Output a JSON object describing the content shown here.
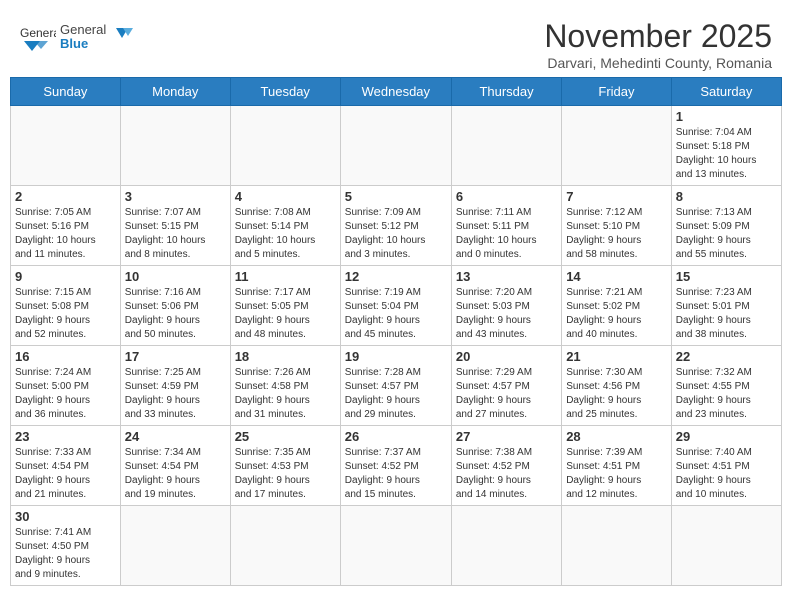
{
  "header": {
    "logo_general": "General",
    "logo_blue": "Blue",
    "month_title": "November 2025",
    "subtitle": "Darvari, Mehedinti County, Romania"
  },
  "weekdays": [
    "Sunday",
    "Monday",
    "Tuesday",
    "Wednesday",
    "Thursday",
    "Friday",
    "Saturday"
  ],
  "days": {
    "d1": {
      "num": "1",
      "info": "Sunrise: 7:04 AM\nSunset: 5:18 PM\nDaylight: 10 hours\nand 13 minutes."
    },
    "d2": {
      "num": "2",
      "info": "Sunrise: 7:05 AM\nSunset: 5:16 PM\nDaylight: 10 hours\nand 11 minutes."
    },
    "d3": {
      "num": "3",
      "info": "Sunrise: 7:07 AM\nSunset: 5:15 PM\nDaylight: 10 hours\nand 8 minutes."
    },
    "d4": {
      "num": "4",
      "info": "Sunrise: 7:08 AM\nSunset: 5:14 PM\nDaylight: 10 hours\nand 5 minutes."
    },
    "d5": {
      "num": "5",
      "info": "Sunrise: 7:09 AM\nSunset: 5:12 PM\nDaylight: 10 hours\nand 3 minutes."
    },
    "d6": {
      "num": "6",
      "info": "Sunrise: 7:11 AM\nSunset: 5:11 PM\nDaylight: 10 hours\nand 0 minutes."
    },
    "d7": {
      "num": "7",
      "info": "Sunrise: 7:12 AM\nSunset: 5:10 PM\nDaylight: 9 hours\nand 58 minutes."
    },
    "d8": {
      "num": "8",
      "info": "Sunrise: 7:13 AM\nSunset: 5:09 PM\nDaylight: 9 hours\nand 55 minutes."
    },
    "d9": {
      "num": "9",
      "info": "Sunrise: 7:15 AM\nSunset: 5:08 PM\nDaylight: 9 hours\nand 52 minutes."
    },
    "d10": {
      "num": "10",
      "info": "Sunrise: 7:16 AM\nSunset: 5:06 PM\nDaylight: 9 hours\nand 50 minutes."
    },
    "d11": {
      "num": "11",
      "info": "Sunrise: 7:17 AM\nSunset: 5:05 PM\nDaylight: 9 hours\nand 48 minutes."
    },
    "d12": {
      "num": "12",
      "info": "Sunrise: 7:19 AM\nSunset: 5:04 PM\nDaylight: 9 hours\nand 45 minutes."
    },
    "d13": {
      "num": "13",
      "info": "Sunrise: 7:20 AM\nSunset: 5:03 PM\nDaylight: 9 hours\nand 43 minutes."
    },
    "d14": {
      "num": "14",
      "info": "Sunrise: 7:21 AM\nSunset: 5:02 PM\nDaylight: 9 hours\nand 40 minutes."
    },
    "d15": {
      "num": "15",
      "info": "Sunrise: 7:23 AM\nSunset: 5:01 PM\nDaylight: 9 hours\nand 38 minutes."
    },
    "d16": {
      "num": "16",
      "info": "Sunrise: 7:24 AM\nSunset: 5:00 PM\nDaylight: 9 hours\nand 36 minutes."
    },
    "d17": {
      "num": "17",
      "info": "Sunrise: 7:25 AM\nSunset: 4:59 PM\nDaylight: 9 hours\nand 33 minutes."
    },
    "d18": {
      "num": "18",
      "info": "Sunrise: 7:26 AM\nSunset: 4:58 PM\nDaylight: 9 hours\nand 31 minutes."
    },
    "d19": {
      "num": "19",
      "info": "Sunrise: 7:28 AM\nSunset: 4:57 PM\nDaylight: 9 hours\nand 29 minutes."
    },
    "d20": {
      "num": "20",
      "info": "Sunrise: 7:29 AM\nSunset: 4:57 PM\nDaylight: 9 hours\nand 27 minutes."
    },
    "d21": {
      "num": "21",
      "info": "Sunrise: 7:30 AM\nSunset: 4:56 PM\nDaylight: 9 hours\nand 25 minutes."
    },
    "d22": {
      "num": "22",
      "info": "Sunrise: 7:32 AM\nSunset: 4:55 PM\nDaylight: 9 hours\nand 23 minutes."
    },
    "d23": {
      "num": "23",
      "info": "Sunrise: 7:33 AM\nSunset: 4:54 PM\nDaylight: 9 hours\nand 21 minutes."
    },
    "d24": {
      "num": "24",
      "info": "Sunrise: 7:34 AM\nSunset: 4:54 PM\nDaylight: 9 hours\nand 19 minutes."
    },
    "d25": {
      "num": "25",
      "info": "Sunrise: 7:35 AM\nSunset: 4:53 PM\nDaylight: 9 hours\nand 17 minutes."
    },
    "d26": {
      "num": "26",
      "info": "Sunrise: 7:37 AM\nSunset: 4:52 PM\nDaylight: 9 hours\nand 15 minutes."
    },
    "d27": {
      "num": "27",
      "info": "Sunrise: 7:38 AM\nSunset: 4:52 PM\nDaylight: 9 hours\nand 14 minutes."
    },
    "d28": {
      "num": "28",
      "info": "Sunrise: 7:39 AM\nSunset: 4:51 PM\nDaylight: 9 hours\nand 12 minutes."
    },
    "d29": {
      "num": "29",
      "info": "Sunrise: 7:40 AM\nSunset: 4:51 PM\nDaylight: 9 hours\nand 10 minutes."
    },
    "d30": {
      "num": "30",
      "info": "Sunrise: 7:41 AM\nSunset: 4:50 PM\nDaylight: 9 hours\nand 9 minutes."
    }
  }
}
